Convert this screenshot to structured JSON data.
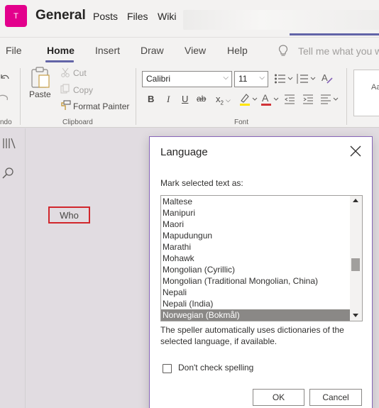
{
  "header": {
    "team_initial": "T",
    "channel_name": "General",
    "tabs": [
      "Posts",
      "Files",
      "Wiki"
    ]
  },
  "ribbon": {
    "tabs": [
      "File",
      "Home",
      "Insert",
      "Draw",
      "View",
      "Help"
    ],
    "active_tab": "Home",
    "tell_me_placeholder": "Tell me what you w",
    "undo_label": "ndo",
    "clipboard": {
      "paste": "Paste",
      "cut": "Cut",
      "copy": "Copy",
      "format_painter": "Format Painter",
      "group_label": "Clipboard"
    },
    "font": {
      "font_name": "Calibri",
      "font_size": "11",
      "group_label": "Font",
      "bold": "B",
      "italic": "I",
      "underline": "U",
      "strike": "ab",
      "subscript": "x",
      "subscript_sub": "2"
    },
    "styles_preview": "Aa"
  },
  "page": {
    "note_text": "Who"
  },
  "dialog": {
    "title": "Language",
    "instruction": "Mark selected text as:",
    "languages": [
      "Maltese",
      "Manipuri",
      "Maori",
      "Mapudungun",
      "Marathi",
      "Mohawk",
      "Mongolian (Cyrillic)",
      "Mongolian (Traditional Mongolian, China)",
      "Nepali",
      "Nepali (India)",
      "Norwegian (Bokmål)"
    ],
    "selected_language": "Norwegian (Bokmål)",
    "note": "The speller automatically uses dictionaries of the selected language, if available.",
    "dont_check_label": "Don't check spelling",
    "dont_check_checked": false,
    "ok_label": "OK",
    "cancel_label": "Cancel"
  },
  "colors": {
    "accent": "#6264a7",
    "team_avatar": "#e3008c",
    "highlight_red": "#d1262c",
    "dialog_border": "#8764b8"
  }
}
